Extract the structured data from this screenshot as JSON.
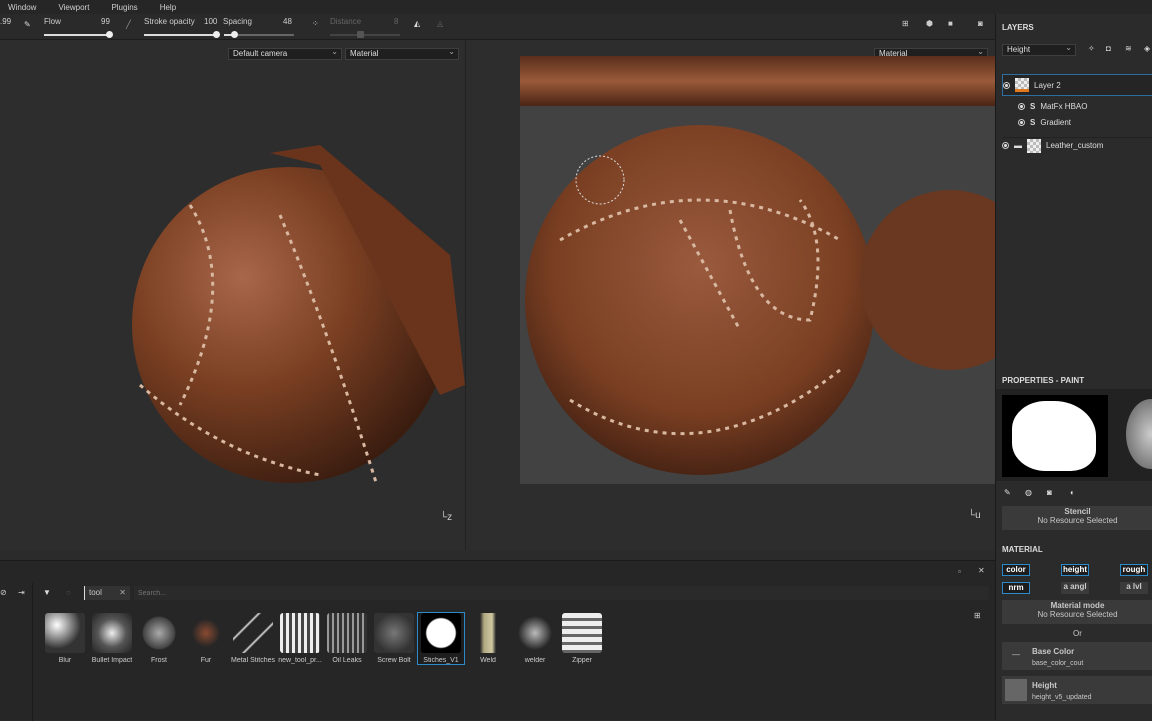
{
  "menu": [
    "Window",
    "Viewport",
    "Plugins",
    "Help"
  ],
  "toolbar": {
    "size_value": ".99",
    "flow_label": "Flow",
    "flow_value": "99",
    "flow": 0.99,
    "stroke_opacity_label": "Stroke opacity",
    "stroke_opacity_value": "100",
    "stroke_opacity": 1.0,
    "spacing_label": "Spacing",
    "spacing_value": "48",
    "distance_label": "Distance",
    "distance_value": "8"
  },
  "viewport3d": {
    "camera": "Default camera",
    "mode": "Material"
  },
  "viewport2d": {
    "mode": "Material"
  },
  "layers": {
    "title": "LAYERS",
    "channel": "Height",
    "items": [
      {
        "name": "Layer 2",
        "selected": true
      },
      {
        "name": "MatFx HBAO",
        "effect": true
      },
      {
        "name": "Gradient",
        "effect": true
      },
      {
        "name": "Leather_custom",
        "folder": true
      }
    ]
  },
  "properties": {
    "title": "PROPERTIES - PAINT",
    "stencil_label": "Stencil",
    "stencil_value": "No Resource Selected",
    "material_title": "MATERIAL",
    "channels": [
      {
        "label": "color",
        "on": true
      },
      {
        "label": "height",
        "on": true
      },
      {
        "label": "rough",
        "on": true
      },
      {
        "label": "nrm",
        "on": true
      },
      {
        "label": "a angl",
        "on": false
      },
      {
        "label": "a lvl",
        "on": false
      }
    ],
    "material_mode_label": "Material mode",
    "material_mode_value": "No Resource Selected",
    "or_label": "Or",
    "base_color_label": "Base Color",
    "base_color_value": "base_color_cout",
    "height_label": "Height",
    "height_value": "height_v5_updated"
  },
  "shelf": {
    "filter_tag": "tool",
    "search_placeholder": "Search...",
    "selected": "Stiches_V1",
    "items": [
      "Blur",
      "Bullet Impact",
      "Frost",
      "Fur",
      "Metal Stitches",
      "new_tool_pr...",
      "Oil Leaks",
      "Screw Bolt",
      "Stiches_V1",
      "Weld",
      "welder",
      "Zipper"
    ]
  },
  "colors": {
    "accent": "#2d8ac8",
    "layer_orange": "#e07a20",
    "leather": "#7a3f22"
  }
}
